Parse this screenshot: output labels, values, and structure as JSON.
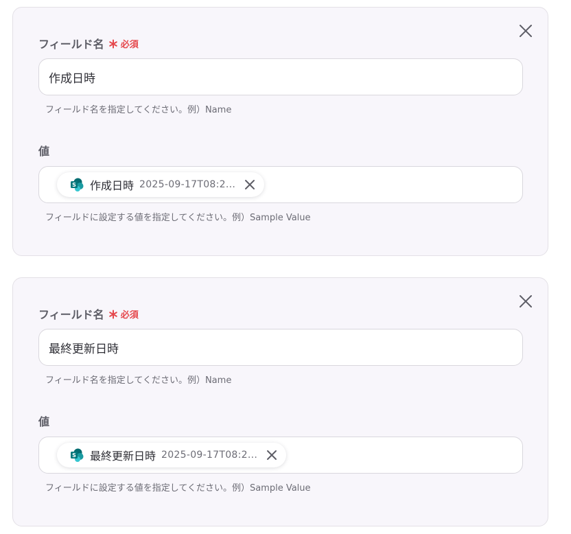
{
  "cards": [
    {
      "field_label": "フィールド名",
      "required_text": "必須",
      "field_value": "作成日時",
      "field_hint": "フィールド名を指定してください。例）Name",
      "value_label": "値",
      "chip": {
        "icon": "sharepoint-icon",
        "name": "作成日時",
        "value": "2025-09-17T08:2..."
      },
      "value_hint": "フィールドに設定する値を指定してください。例）Sample Value"
    },
    {
      "field_label": "フィールド名",
      "required_text": "必須",
      "field_value": "最終更新日時",
      "field_hint": "フィールド名を指定してください。例）Name",
      "value_label": "値",
      "chip": {
        "icon": "sharepoint-icon",
        "name": "最終更新日時",
        "value": "2025-09-17T08:2..."
      },
      "value_hint": "フィールドに設定する値を指定してください。例）Sample Value"
    }
  ],
  "colors": {
    "card_background": "#f8f6fb",
    "required": "#e5484d",
    "sharepoint_teal": "#038387"
  }
}
